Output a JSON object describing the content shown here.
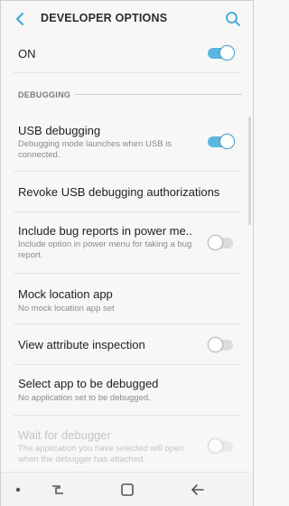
{
  "header": {
    "title": "DEVELOPER OPTIONS",
    "back_icon": "back-arrow-icon",
    "search_icon": "search-icon"
  },
  "master": {
    "label": "ON",
    "state": "on"
  },
  "section": {
    "header": "DEBUGGING"
  },
  "items": [
    {
      "label": "USB debugging",
      "sub": "Debugging mode launches when USB is connected.",
      "toggle": "on"
    },
    {
      "label": "Revoke USB debugging authorizations",
      "sub": "",
      "toggle": "none"
    },
    {
      "label": "Include bug reports in power me..",
      "sub": "Include option in power menu for taking a bug report.",
      "toggle": "off"
    },
    {
      "label": "Mock location app",
      "sub": "No mock location app set",
      "toggle": "none"
    },
    {
      "label": "View attribute inspection",
      "sub": "",
      "toggle": "off"
    },
    {
      "label": "Select app to be debugged",
      "sub": "No application set to be debugged.",
      "toggle": "none"
    },
    {
      "label": "Wait for debugger",
      "sub": "The application you have selected will open when the debugger has attached.",
      "toggle": "off-disabled"
    }
  ],
  "navbar": {
    "left": "dot-icon",
    "recents": "recents-icon",
    "home": "home-icon",
    "back": "back-icon"
  },
  "colors": {
    "accent": "#5ab7e0",
    "background": "#f7f7f7"
  }
}
